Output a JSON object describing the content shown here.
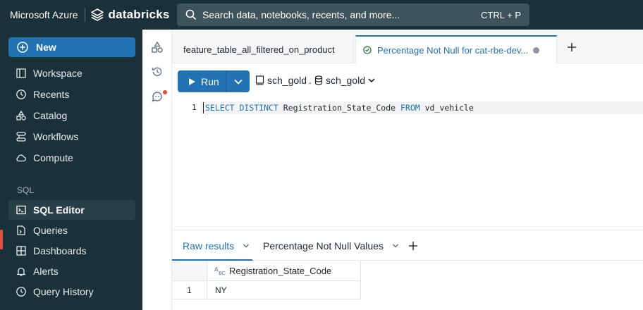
{
  "header": {
    "brand_ms": "Microsoft Azure",
    "brand_db": "databricks",
    "search_placeholder": "Search data, notebooks, recents, and more...",
    "search_shortcut": "CTRL + P"
  },
  "sidebar": {
    "new_label": "New",
    "items": [
      {
        "label": "Workspace",
        "icon": "workspace-icon"
      },
      {
        "label": "Recents",
        "icon": "clock-icon"
      },
      {
        "label": "Catalog",
        "icon": "catalog-icon"
      },
      {
        "label": "Workflows",
        "icon": "workflows-icon"
      },
      {
        "label": "Compute",
        "icon": "cloud-icon"
      }
    ],
    "section_sql": "SQL",
    "sql_items": [
      {
        "label": "SQL Editor",
        "icon": "sql-editor-icon",
        "active": true
      },
      {
        "label": "Queries",
        "icon": "queries-icon"
      },
      {
        "label": "Dashboards",
        "icon": "dashboards-icon"
      },
      {
        "label": "Alerts",
        "icon": "bell-icon"
      },
      {
        "label": "Query History",
        "icon": "history-icon"
      }
    ]
  },
  "tabs": {
    "tab1": "feature_table_all_filtered_on_product",
    "tab2": "Percentage Not Null for cat-rbe-dev..."
  },
  "toolbar": {
    "run_label": "Run",
    "catalog": "sch_gold",
    "schema": "sch_gold"
  },
  "editor": {
    "line_number": "1",
    "kw1": "SELECT DISTINCT",
    "col": "Registration_State_Code",
    "kw2": "FROM",
    "table": "vd_vehicle"
  },
  "results": {
    "tab_raw": "Raw results",
    "tab_viz": "Percentage Not Null Values",
    "column": "Registration_State_Code",
    "rows": [
      {
        "index": "1",
        "value": "NY"
      }
    ]
  },
  "colors": {
    "topbar": "#1b3139",
    "accent": "#2272b4",
    "active_marker": "#e0503c"
  }
}
